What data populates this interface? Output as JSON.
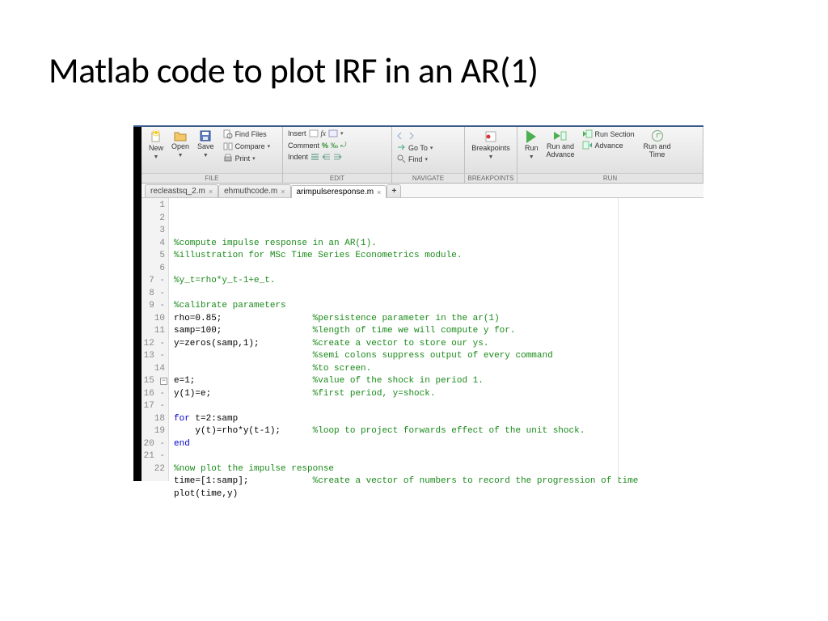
{
  "slide": {
    "title": "Matlab code to plot IRF in an AR(1)"
  },
  "toolstrip": {
    "sections": {
      "file": {
        "label": "FILE",
        "new": "New",
        "open": "Open",
        "save": "Save",
        "find_files": "Find Files",
        "compare": "Compare",
        "print": "Print"
      },
      "edit": {
        "label": "EDIT",
        "insert": "Insert",
        "comment": "Comment",
        "indent": "Indent"
      },
      "navigate": {
        "label": "NAVIGATE",
        "goto": "Go To",
        "find": "Find"
      },
      "breakpoints": {
        "label": "BREAKPOINTS",
        "btn": "Breakpoints"
      },
      "run": {
        "label": "RUN",
        "run": "Run",
        "run_advance": "Run and\nAdvance",
        "run_section": "Run Section",
        "advance": "Advance",
        "run_time": "Run and\nTime"
      }
    }
  },
  "tabs": {
    "items": [
      {
        "name": "recleastsq_2.m",
        "active": false
      },
      {
        "name": "ehmuthcode.m",
        "active": false
      },
      {
        "name": "arimpulseresponse.m",
        "active": true
      }
    ],
    "plus": "+"
  },
  "code": {
    "lines": [
      {
        "n": "1",
        "dash": false,
        "text": "%compute impulse response in an AR(1).",
        "type": "comment"
      },
      {
        "n": "2",
        "dash": false,
        "text": "%illustration for MSc Time Series Econometrics module.",
        "type": "comment"
      },
      {
        "n": "3",
        "dash": false,
        "text": "",
        "type": "blank"
      },
      {
        "n": "4",
        "dash": false,
        "text": "%y_t=rho*y_t-1+e_t.",
        "type": "comment"
      },
      {
        "n": "5",
        "dash": false,
        "text": "",
        "type": "blank"
      },
      {
        "n": "6",
        "dash": false,
        "text": "%calibrate parameters",
        "type": "comment"
      },
      {
        "n": "7",
        "dash": true,
        "code": "rho=0.85;",
        "cmt": "%persistence parameter in the ar(1)"
      },
      {
        "n": "8",
        "dash": true,
        "code": "samp=100;",
        "cmt": "%length of time we will compute y for."
      },
      {
        "n": "9",
        "dash": true,
        "code": "y=zeros(samp,1);",
        "cmt": "%create a vector to store our ys."
      },
      {
        "n": "10",
        "dash": false,
        "code": "",
        "cmt": "%semi colons suppress output of every command"
      },
      {
        "n": "11",
        "dash": false,
        "code": "",
        "cmt": "%to screen."
      },
      {
        "n": "12",
        "dash": true,
        "code": "e=1;",
        "cmt": "%value of the shock in period 1."
      },
      {
        "n": "13",
        "dash": true,
        "code": "y(1)=e;",
        "cmt": "%first period, y=shock."
      },
      {
        "n": "14",
        "dash": false,
        "text": "",
        "type": "blank"
      },
      {
        "n": "15",
        "dash": true,
        "raw": "for t=2:samp",
        "indent": 0,
        "kw": "for"
      },
      {
        "n": "16",
        "dash": true,
        "code": "    y(t)=rho*y(t-1);",
        "cmt": "%loop to project forwards effect of the unit shock."
      },
      {
        "n": "17",
        "dash": true,
        "raw": "end",
        "indent": 0,
        "kw": "end"
      },
      {
        "n": "18",
        "dash": false,
        "text": "",
        "type": "blank"
      },
      {
        "n": "19",
        "dash": false,
        "text": "%now plot the impulse response",
        "type": "comment"
      },
      {
        "n": "20",
        "dash": true,
        "code": "time=[1:samp];",
        "cmt": "%create a vector of numbers to record the progression of time"
      },
      {
        "n": "21",
        "dash": true,
        "code": "plot(time,y)",
        "cmt": ""
      },
      {
        "n": "22",
        "dash": false,
        "text": "",
        "type": "blank"
      }
    ],
    "fold_at_line": 15
  }
}
